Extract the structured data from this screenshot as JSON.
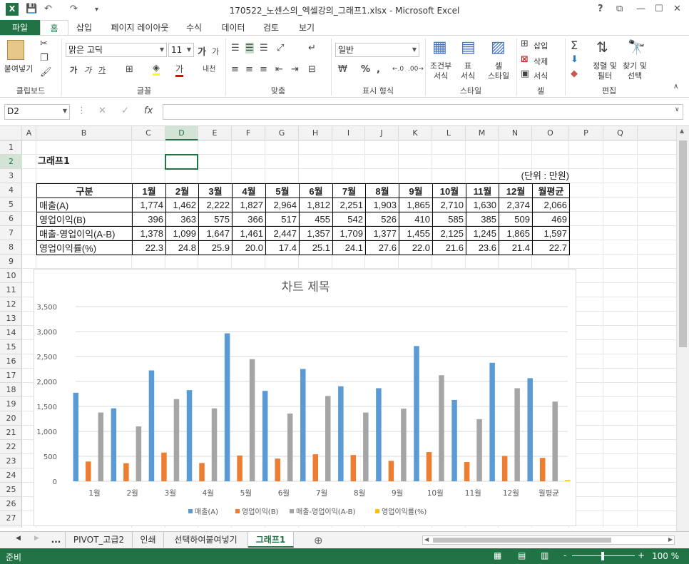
{
  "window": {
    "title": "170522_노센스의_엑셀강의_그래프1.xlsx - Microsoft Excel",
    "help": "?",
    "restore": "⧉",
    "minimize": "—",
    "maximize": "☐",
    "close": "✕"
  },
  "qat": {
    "save": "💾",
    "undo": "↶",
    "redo": "↷",
    "customize": "▾"
  },
  "tabs": [
    "파일",
    "홈",
    "삽입",
    "페이지 레이아웃",
    "수식",
    "데이터",
    "검토",
    "보기"
  ],
  "ribbon": {
    "clipboard": {
      "paste": "붙여넣기",
      "label": "클립보드"
    },
    "font": {
      "name": "맑은 고딕",
      "size": "11",
      "grow": "가",
      "shrink": "가",
      "bold": "가",
      "italic": "가",
      "underline": "가",
      "color_letter": "가",
      "phonetic": "내천",
      "label": "글꼴"
    },
    "alignment": {
      "label": "맞춤"
    },
    "number": {
      "format": "일반",
      "percent": "%",
      "comma": ",",
      "label": "표시 형식"
    },
    "styles": {
      "conditional": "조건부\n서식",
      "table": "표\n서식",
      "cell": "셀\n스타일",
      "label": "스타일"
    },
    "cells": {
      "insert": "삽입",
      "delete": "삭제",
      "format": "서식",
      "label": "셀"
    },
    "editing": {
      "sort": "정렬 및\n필터",
      "find": "찾기 및\n선택",
      "label": "편집"
    }
  },
  "formula_bar": {
    "name_box": "D2",
    "value": "",
    "fx": "fx"
  },
  "columns": [
    "A",
    "B",
    "C",
    "D",
    "E",
    "F",
    "G",
    "H",
    "I",
    "J",
    "K",
    "L",
    "M",
    "N",
    "O",
    "P",
    "Q"
  ],
  "rows": [
    "1",
    "2",
    "3",
    "4",
    "5",
    "6",
    "7",
    "8",
    "9",
    "10",
    "11",
    "12",
    "13",
    "14",
    "15",
    "16",
    "17",
    "18",
    "19",
    "20",
    "21",
    "22",
    "23",
    "24",
    "25",
    "26",
    "27"
  ],
  "selected_cell": "D2",
  "sheet": {
    "title": "그래프1",
    "unit": "(단위 : 만원)",
    "headers": [
      "구분",
      "1월",
      "2월",
      "3월",
      "4월",
      "5월",
      "6월",
      "7월",
      "8월",
      "9월",
      "10월",
      "11월",
      "12월",
      "월평균"
    ],
    "rows": [
      [
        "매출(A)",
        "1,774",
        "1,462",
        "2,222",
        "1,827",
        "2,964",
        "1,812",
        "2,251",
        "1,903",
        "1,865",
        "2,710",
        "1,630",
        "2,374",
        "2,066"
      ],
      [
        "영업이익(B)",
        "396",
        "363",
        "575",
        "366",
        "517",
        "455",
        "542",
        "526",
        "410",
        "585",
        "385",
        "509",
        "469"
      ],
      [
        "매출-영업이익(A-B)",
        "1,378",
        "1,099",
        "1,647",
        "1,461",
        "2,447",
        "1,357",
        "1,709",
        "1,377",
        "1,455",
        "2,125",
        "1,245",
        "1,865",
        "1,597"
      ],
      [
        "영업이익률(%)",
        "22.3",
        "24.8",
        "25.9",
        "20.0",
        "17.4",
        "25.1",
        "24.1",
        "27.6",
        "22.0",
        "21.6",
        "23.6",
        "21.4",
        "22.7"
      ]
    ]
  },
  "chart_data": {
    "type": "bar",
    "title": "차트 제목",
    "categories": [
      "1월",
      "2월",
      "3월",
      "4월",
      "5월",
      "6월",
      "7월",
      "8월",
      "9월",
      "10월",
      "11월",
      "12월",
      "월평균"
    ],
    "ylim": [
      0,
      3500
    ],
    "yticks": [
      "0",
      "500",
      "1,000",
      "1,500",
      "2,000",
      "2,500",
      "3,000",
      "3,500"
    ],
    "grid": true,
    "legend_position": "bottom",
    "series": [
      {
        "name": "매출(A)",
        "color": "#5B9BD5",
        "values": [
          1774,
          1462,
          2222,
          1827,
          2964,
          1812,
          2251,
          1903,
          1865,
          2710,
          1630,
          2374,
          2066
        ]
      },
      {
        "name": "영업이익(B)",
        "color": "#ED7D31",
        "values": [
          396,
          363,
          575,
          366,
          517,
          455,
          542,
          526,
          410,
          585,
          385,
          509,
          469
        ]
      },
      {
        "name": "매출-영업이익(A-B)",
        "color": "#A5A5A5",
        "values": [
          1378,
          1099,
          1647,
          1461,
          2447,
          1357,
          1709,
          1377,
          1455,
          2125,
          1245,
          1865,
          1597
        ]
      },
      {
        "name": "영업이익률(%)",
        "color": "#FFC000",
        "values": [
          22.3,
          24.8,
          25.9,
          20.0,
          17.4,
          25.1,
          24.1,
          27.6,
          22.0,
          21.6,
          23.6,
          21.4,
          22.7
        ]
      }
    ]
  },
  "sheet_tabs": [
    "...",
    "PIVOT_고급2",
    "인쇄",
    "선택하여붙여넣기",
    "그래프1"
  ],
  "active_sheet": "그래프1",
  "add_sheet": "⊕",
  "status": {
    "mode": "준비",
    "zoom": "100 %",
    "zoom_minus": "-",
    "zoom_plus": "+"
  }
}
